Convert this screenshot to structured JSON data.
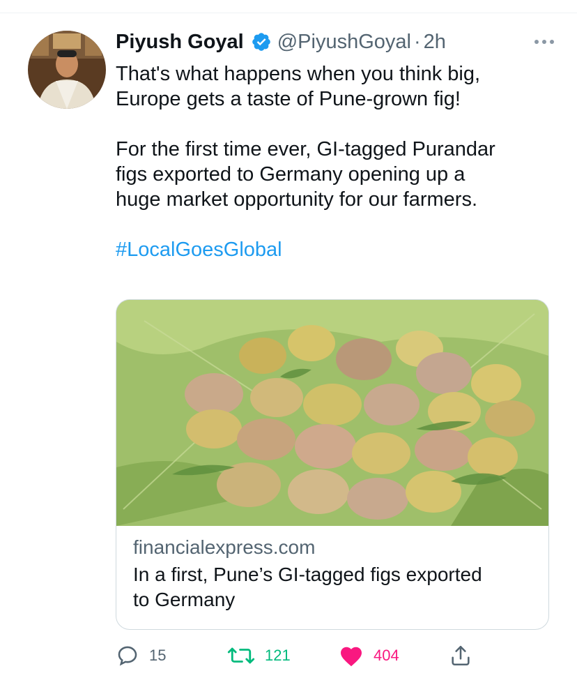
{
  "tweet": {
    "author_name": "Piyush Goyal",
    "handle": "@PiyushGoyal",
    "separator": "·",
    "time": "2h",
    "text_line1": "That's what happens when you think big,",
    "text_line2": "Europe gets a taste of Pune-grown fig!",
    "text_line3": "For the first time ever, GI-tagged Purandar",
    "text_line4": "figs exported to Germany opening up a",
    "text_line5": "huge market opportunity for our farmers.",
    "hashtag": "#LocalGoesGlobal"
  },
  "card": {
    "domain": "financialexpress.com",
    "title_line1": "In a first, Pune’s GI-tagged figs exported",
    "title_line2": "to Germany"
  },
  "actions": {
    "replies": "15",
    "retweets": "121",
    "likes": "404"
  },
  "colors": {
    "link": "#1d9bf0",
    "retweet": "#00ba7c",
    "like": "#f91880",
    "secondary": "#536471"
  },
  "icons": [
    "verified-badge-icon",
    "more-icon",
    "reply-icon",
    "retweet-icon",
    "like-icon",
    "share-icon"
  ]
}
